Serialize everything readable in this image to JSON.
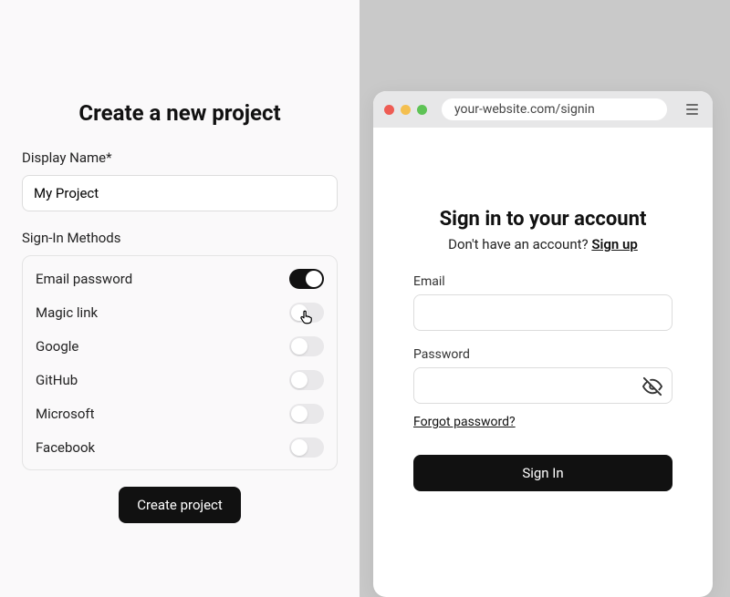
{
  "left": {
    "title": "Create a new project",
    "display_name_label": "Display Name*",
    "display_name_value": "My Project",
    "sign_in_methods_label": "Sign-In Methods",
    "methods": [
      {
        "key": "email-password",
        "label": "Email password",
        "on": true
      },
      {
        "key": "magic-link",
        "label": "Magic link",
        "on": false,
        "cursor": true
      },
      {
        "key": "google",
        "label": "Google",
        "on": false
      },
      {
        "key": "github",
        "label": "GitHub",
        "on": false
      },
      {
        "key": "microsoft",
        "label": "Microsoft",
        "on": false
      },
      {
        "key": "facebook",
        "label": "Facebook",
        "on": false
      }
    ],
    "create_button": "Create project"
  },
  "right": {
    "url": "your-website.com/signin",
    "title": "Sign in to your account",
    "subtitle_prefix": "Don't have an account? ",
    "signup_link": "Sign up",
    "email_label": "Email",
    "password_label": "Password",
    "forgot": "Forgot password?",
    "signin_button": "Sign In"
  }
}
